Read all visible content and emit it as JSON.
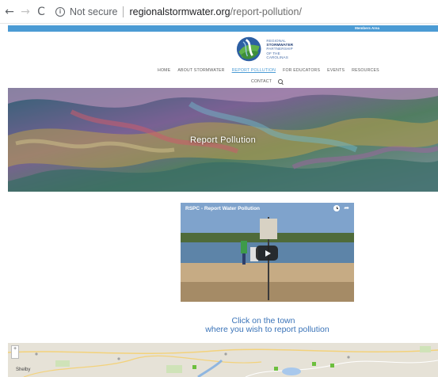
{
  "browser": {
    "security_label": "Not secure",
    "url_host": "regionalstormwater.org",
    "url_path": "/report-pollution/"
  },
  "topbar": {
    "members_area": "Members Area",
    "color": "#4b9bd4"
  },
  "logo": {
    "line1": "REGIONAL",
    "line2": "STORMWATER",
    "line3": "PARTNERSHIP",
    "line4": "OF THE CAROLINAS"
  },
  "nav": {
    "items": [
      {
        "label": "HOME"
      },
      {
        "label": "ABOUT STORMWATER"
      },
      {
        "label": "REPORT POLLUTION",
        "active": true
      },
      {
        "label": "FOR EDUCATORS"
      },
      {
        "label": "EVENTS"
      },
      {
        "label": "RESOURCES"
      },
      {
        "label": "CONTACT"
      }
    ],
    "search_icon": "search-icon"
  },
  "hero": {
    "title": "Report Pollution"
  },
  "video": {
    "title": "RSPC - Report Water Pollution",
    "icons": [
      "clock-icon",
      "share-icon",
      "play-icon"
    ]
  },
  "cta": {
    "line1": "Click on the town",
    "line2": "where you wish to report pollution",
    "color": "#3a73b8"
  },
  "map": {
    "zoom_label": "+",
    "label": "Shelby"
  }
}
